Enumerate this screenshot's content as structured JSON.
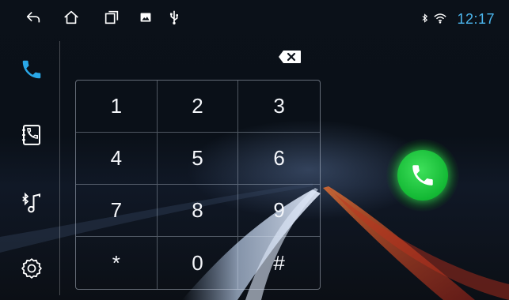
{
  "status_bar": {
    "time": "12:17",
    "nav_icons": [
      "back-icon",
      "home-icon",
      "recent-apps-icon",
      "image-icon",
      "usb-icon"
    ],
    "system_icons": [
      "bluetooth-icon",
      "wifi-icon"
    ],
    "clock_color": "#4cb8f0"
  },
  "sidebar": {
    "items": [
      {
        "icon": "phone-icon",
        "active": true
      },
      {
        "icon": "contacts-icon",
        "active": false
      },
      {
        "icon": "bluetooth-music-icon",
        "active": false
      },
      {
        "icon": "settings-icon",
        "active": false
      }
    ],
    "accent": "#2aa8e8"
  },
  "dialer": {
    "number": "",
    "backspace_icon": "backspace-icon",
    "keys": [
      "1",
      "2",
      "3",
      "4",
      "5",
      "6",
      "7",
      "8",
      "9",
      "*",
      "0",
      "#"
    ],
    "call_icon": "call-icon",
    "call_color": "#1fc23d"
  }
}
